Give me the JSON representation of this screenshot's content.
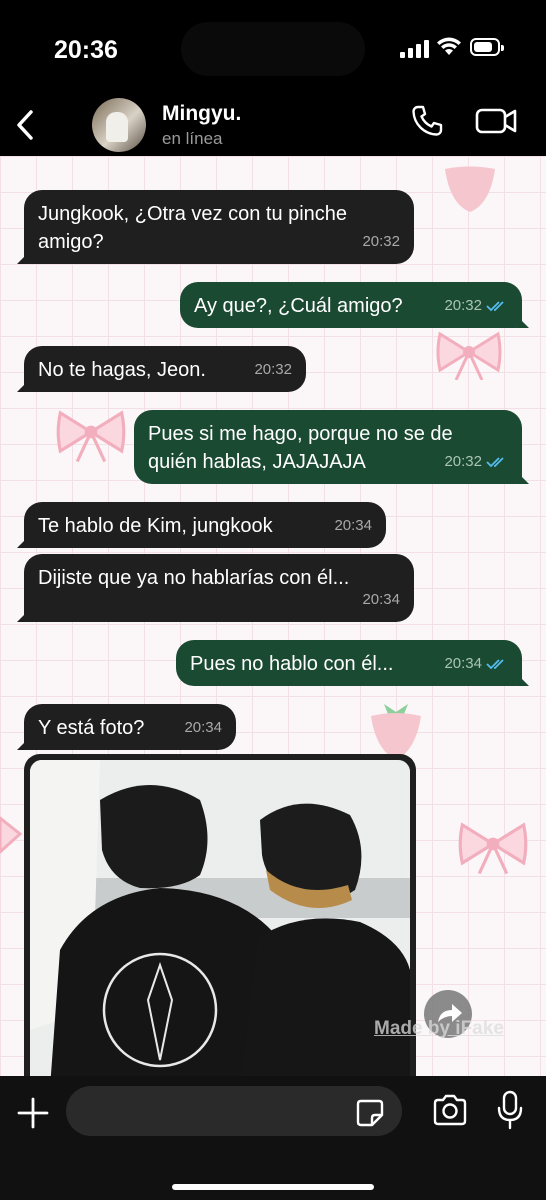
{
  "status_bar": {
    "time": "20:36",
    "battery_level": 0.8
  },
  "header": {
    "contact_name": "Mingyu.",
    "presence": "en línea",
    "back_icon": "chevron-left-icon",
    "call_icon": "phone-icon",
    "video_icon": "video-camera-icon"
  },
  "messages": [
    {
      "direction": "in",
      "text": "Jungkook, ¿Otra vez con tu pinche\namigo?",
      "time": "20:32"
    },
    {
      "direction": "out",
      "text": "Ay que?, ¿Cuál amigo?",
      "time": "20:32",
      "read": true
    },
    {
      "direction": "in",
      "text": "No te hagas, Jeon.",
      "time": "20:32"
    },
    {
      "direction": "out",
      "text": "Pues si me hago, porque no se de\nquién hablas, JAJAJAJA",
      "time": "20:32",
      "read": true
    },
    {
      "direction": "in",
      "text": "Te hablo de Kim, jungkook",
      "time": "20:34"
    },
    {
      "direction": "in",
      "text": "Dijiste que ya no hablarías con él...",
      "time": "20:34"
    },
    {
      "direction": "out",
      "text": "Pues no hablo con él...",
      "time": "20:34",
      "read": true
    },
    {
      "direction": "in",
      "text": "Y está foto?",
      "time": "20:34"
    }
  ],
  "photo": {
    "description_icon": "photo-attachment",
    "share_icon": "forward-arrow-icon"
  },
  "watermark": "Made by iFake",
  "input_bar": {
    "plus_icon": "plus-icon",
    "sticker_icon": "sticker-icon",
    "camera_icon": "camera-icon",
    "mic_icon": "microphone-icon"
  },
  "colors": {
    "incoming_bubble": "#1f1f1f",
    "outgoing_bubble": "#1b4a33",
    "read_ticks": "#53bdeb"
  }
}
